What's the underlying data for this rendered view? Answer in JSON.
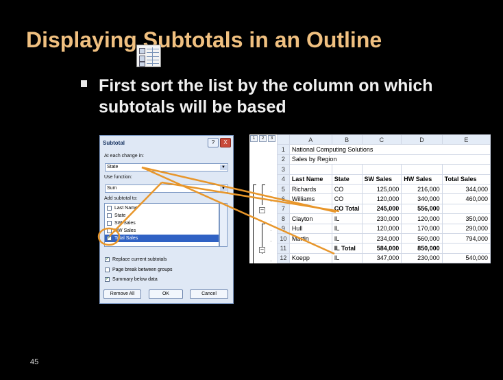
{
  "slide": {
    "title": "Displaying Subtotals in an Outline",
    "bullet": "First sort the list by the column on which subtotals will be based",
    "page_number": "45"
  },
  "dialog": {
    "title": "Subtotal",
    "help_label": "?",
    "close_label": "X",
    "at_each_change_label": "At each change in:",
    "at_each_change_value": "State",
    "use_function_label": "Use function:",
    "use_function_value": "Sum",
    "add_subtotal_label": "Add subtotal to:",
    "subtotal_fields": [
      {
        "label": "Last Name",
        "checked": false
      },
      {
        "label": "State",
        "checked": false
      },
      {
        "label": "SW Sales",
        "checked": false
      },
      {
        "label": "HW Sales",
        "checked": false
      },
      {
        "label": "Total Sales",
        "checked": true,
        "selected": true
      }
    ],
    "options": [
      {
        "label": "Replace current subtotals",
        "checked": true
      },
      {
        "label": "Page break between groups",
        "checked": false
      },
      {
        "label": "Summary below data",
        "checked": true
      }
    ],
    "remove_all_label": "Remove All",
    "ok_label": "OK",
    "cancel_label": "Cancel"
  },
  "sheet": {
    "levels": [
      "1",
      "2",
      "3"
    ],
    "columns": [
      "A",
      "B",
      "C",
      "D",
      "E"
    ],
    "rows": [
      {
        "num": "1",
        "cells": [
          "National Computing Solutions",
          "",
          "",
          "",
          ""
        ]
      },
      {
        "num": "2",
        "cells": [
          "Sales by Region",
          "",
          "",
          "",
          ""
        ]
      },
      {
        "num": "3",
        "cells": [
          "",
          "",
          "",
          "",
          ""
        ]
      },
      {
        "num": "4",
        "cells": [
          "Last Name",
          "State",
          "SW Sales",
          "HW Sales",
          "Total Sales"
        ],
        "header": true
      },
      {
        "num": "5",
        "cells": [
          "Richards",
          "CO",
          "125,000",
          "216,000",
          "344,000"
        ]
      },
      {
        "num": "6",
        "cells": [
          "Williams",
          "CO",
          "120,000",
          "340,000",
          "460,000"
        ]
      },
      {
        "num": "7",
        "cells": [
          "",
          "CO Total",
          "245,000",
          "556,000",
          ""
        ],
        "subtotal": true
      },
      {
        "num": "8",
        "cells": [
          "Clayton",
          "IL",
          "230,000",
          "120,000",
          "350,000"
        ]
      },
      {
        "num": "9",
        "cells": [
          "Hull",
          "IL",
          "120,000",
          "170,000",
          "290,000"
        ]
      },
      {
        "num": "10",
        "cells": [
          "Martin",
          "IL",
          "234,000",
          "560,000",
          "794,000"
        ]
      },
      {
        "num": "11",
        "cells": [
          "",
          "IL Total",
          "584,000",
          "850,000",
          ""
        ],
        "subtotal": true
      },
      {
        "num": "12",
        "cells": [
          "Koepp",
          "IL",
          "347,000",
          "230,000",
          "540,000"
        ]
      }
    ]
  },
  "colors": {
    "title": "#f0c080",
    "background": "#000000",
    "callout_arrow": "#e8962a",
    "selection": "#3062c4"
  }
}
